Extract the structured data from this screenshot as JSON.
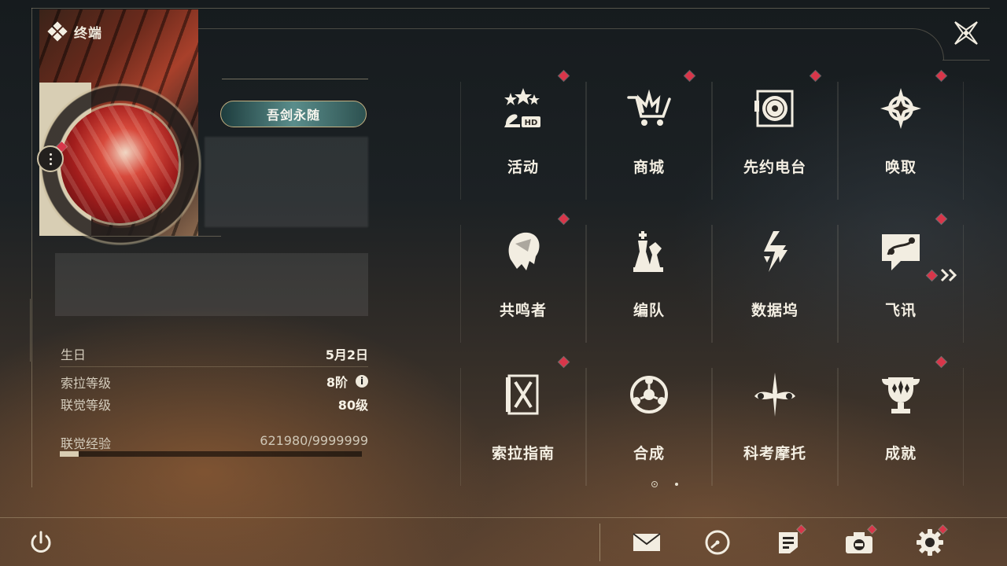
{
  "header": {
    "title": "终端",
    "logo_icon": "diamond-cluster-icon",
    "close_icon": "close-icon"
  },
  "profile": {
    "title_badge": "吾剑永随",
    "birthday_label": "生日",
    "birthday_value": "5月2日",
    "sola_level_label": "索拉等级",
    "sola_level_value": "8阶",
    "union_level_label": "联觉等级",
    "union_level_value": "80级",
    "union_exp_label": "联觉经验",
    "union_exp_value": "621980/9999999",
    "union_exp_progress": 0.062198
  },
  "menu": {
    "items": [
      {
        "label": "活动",
        "icon": "event-2nd-anniversary-icon",
        "badge": true
      },
      {
        "label": "商城",
        "icon": "shop-cart-icon",
        "badge": true
      },
      {
        "label": "先约电台",
        "icon": "radio-vinyl-icon",
        "badge": true
      },
      {
        "label": "唤取",
        "icon": "convene-compass-icon",
        "badge": true
      },
      {
        "label": "共鸣者",
        "icon": "resonator-portrait-icon",
        "badge": true
      },
      {
        "label": "编队",
        "icon": "team-chess-icon",
        "badge": false
      },
      {
        "label": "数据坞",
        "icon": "data-bank-icon",
        "badge": false
      },
      {
        "label": "飞讯",
        "icon": "chat-message-icon",
        "badge": true
      },
      {
        "label": "索拉指南",
        "icon": "guidebook-icon",
        "badge": true
      },
      {
        "label": "合成",
        "icon": "synthesis-icon",
        "badge": false
      },
      {
        "label": "科考摩托",
        "icon": "motorcycle-icon",
        "badge": false
      },
      {
        "label": "成就",
        "icon": "trophy-icon",
        "badge": true
      }
    ],
    "next_page_icon": "double-chevron-right-icon",
    "pages": 2,
    "current_page": 1
  },
  "bottom_bar": {
    "power_icon": "power-icon",
    "right_icons": [
      {
        "name": "mail-icon",
        "badge": false
      },
      {
        "name": "clock-icon",
        "badge": false
      },
      {
        "name": "notice-icon",
        "badge": true
      },
      {
        "name": "camera-icon",
        "badge": true
      },
      {
        "name": "settings-gear-icon",
        "badge": true
      }
    ]
  },
  "colors": {
    "accent_red": "#d8364a",
    "text_cream": "#f4efe3",
    "badge_teal": "#3d6d6c"
  }
}
